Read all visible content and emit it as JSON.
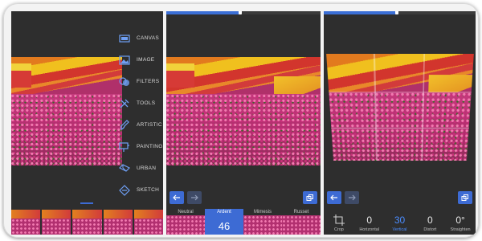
{
  "colors": {
    "accent": "#3d6bd4",
    "panel_bg": "#2e2e2e",
    "active_value": "#4a8cff"
  },
  "panel1": {
    "menu": [
      {
        "label": "CANVAS",
        "icon": "canvas-icon"
      },
      {
        "label": "IMAGE",
        "icon": "image-icon"
      },
      {
        "label": "FILTERS",
        "icon": "filters-icon"
      },
      {
        "label": "TOOLS",
        "icon": "tools-icon"
      },
      {
        "label": "ARTISTIC",
        "icon": "artistic-icon"
      },
      {
        "label": "PAINTING",
        "icon": "painting-icon"
      },
      {
        "label": "URBAN",
        "icon": "urban-icon"
      },
      {
        "label": "SKETCH",
        "icon": "sketch-icon"
      }
    ]
  },
  "panel2": {
    "filters": [
      {
        "label": "Neutral"
      },
      {
        "label": "Ardent",
        "value": "46",
        "active": true
      },
      {
        "label": "Mimesis"
      },
      {
        "label": "Russet"
      }
    ],
    "progress": 0.48
  },
  "panel3": {
    "controls": [
      {
        "label": "Crop",
        "value": "",
        "icon": "crop-icon"
      },
      {
        "label": "Horizontal",
        "value": "0"
      },
      {
        "label": "Vertical",
        "value": "30",
        "active": true
      },
      {
        "label": "Distort",
        "value": "0"
      },
      {
        "label": "Straighten",
        "value": "0°"
      }
    ],
    "progress": 0.48
  }
}
